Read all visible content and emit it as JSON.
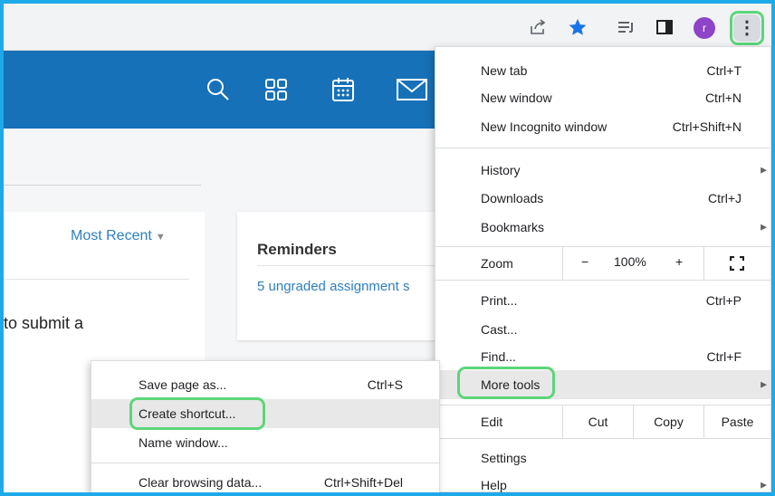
{
  "toolbar": {
    "icons": [
      "share-icon",
      "star-icon",
      "reading-list-icon",
      "side-panel-icon",
      "kebab-menu-icon"
    ],
    "avatar_letter": "r",
    "menu_button_glyph": "⋮",
    "colors": {
      "star": "#1a73e8",
      "avatar": "#8e44c9",
      "highlight_ring": "#5cd67a",
      "app_header": "#1671b8"
    }
  },
  "app": {
    "header_icons": [
      "search-icon",
      "apps-grid-icon",
      "calendar-icon",
      "mail-icon"
    ],
    "sort_label": "Most Recent",
    "sort_caret": "▼",
    "partial_text": "to submit a",
    "reminders": {
      "title": "Reminders",
      "link": "5 ungraded assignment s"
    }
  },
  "menu": {
    "items": [
      {
        "label": "New tab",
        "shortcut": "Ctrl+T"
      },
      {
        "label": "New window",
        "shortcut": "Ctrl+N"
      },
      {
        "label": "New Incognito window",
        "shortcut": "Ctrl+Shift+N"
      },
      {
        "label": "History",
        "shortcut": "",
        "arrow": "▶"
      },
      {
        "label": "Downloads",
        "shortcut": "Ctrl+J"
      },
      {
        "label": "Bookmarks",
        "shortcut": "",
        "arrow": "▶"
      },
      {
        "label": "Print...",
        "shortcut": "Ctrl+P"
      },
      {
        "label": "Cast..."
      },
      {
        "label": "Find...",
        "shortcut": "Ctrl+F"
      },
      {
        "label": "More tools",
        "arrow": "▶"
      },
      {
        "label": "Settings"
      },
      {
        "label": "Help",
        "arrow": "▶"
      }
    ],
    "zoom": {
      "label": "Zoom",
      "minus": "−",
      "value": "100%",
      "plus": "+",
      "fullscreen": "⛶"
    },
    "edit": {
      "label": "Edit",
      "cut": "Cut",
      "copy": "Copy",
      "paste": "Paste"
    }
  },
  "submenu": {
    "items": [
      {
        "label": "Save page as...",
        "shortcut": "Ctrl+S"
      },
      {
        "label": "Create shortcut..."
      },
      {
        "label": "Name window..."
      },
      {
        "label": "Clear browsing data...",
        "shortcut": "Ctrl+Shift+Del"
      }
    ]
  }
}
